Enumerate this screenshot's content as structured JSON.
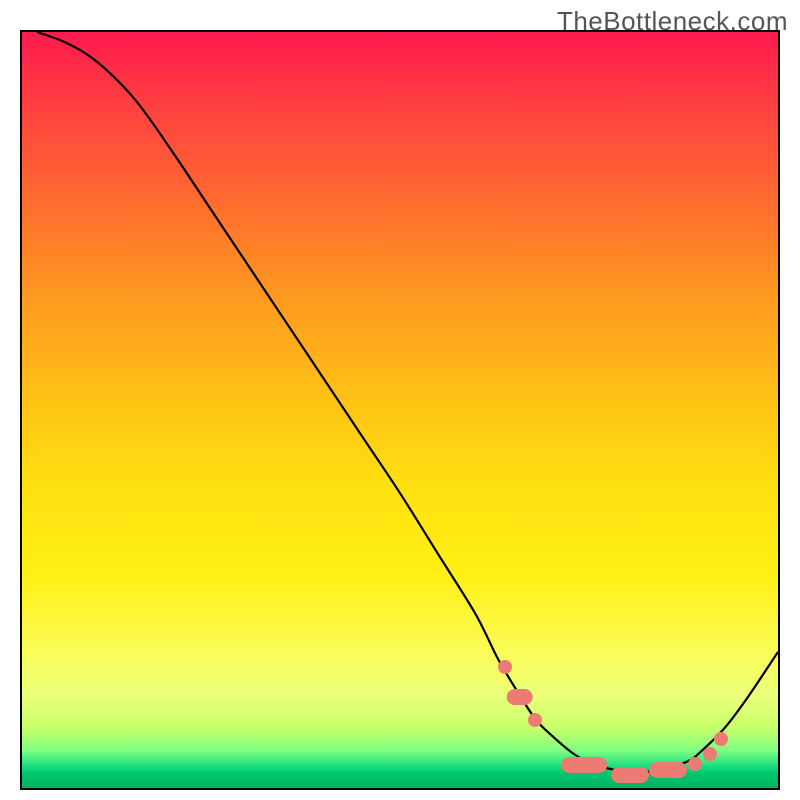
{
  "watermark": "TheBottleneck.com",
  "chart_data": {
    "type": "line",
    "title": "",
    "xlabel": "",
    "ylabel": "",
    "xlim": [
      0,
      100
    ],
    "ylim": [
      0,
      100
    ],
    "grid": false,
    "legend": false,
    "series": [
      {
        "name": "curve",
        "x": [
          2,
          6,
          10,
          15,
          20,
          25,
          30,
          35,
          40,
          45,
          50,
          55,
          60,
          63,
          66,
          68,
          70,
          73,
          76,
          80,
          84,
          88,
          90,
          93,
          96,
          100
        ],
        "y": [
          100,
          98.5,
          96,
          91,
          84,
          76.5,
          69,
          61.5,
          54,
          46.5,
          39,
          31,
          23,
          17,
          12,
          9,
          7,
          4.5,
          3,
          2.2,
          2.3,
          3.5,
          5,
          8,
          12,
          18
        ]
      }
    ],
    "markers": [
      {
        "kind": "dot",
        "x": 63.5,
        "y": 16.5
      },
      {
        "kind": "blob",
        "x": 65.5,
        "y": 12.5,
        "w": 3.5
      },
      {
        "kind": "dot",
        "x": 67.5,
        "y": 9.5
      },
      {
        "kind": "blob",
        "x": 74.0,
        "y": 3.5,
        "w": 6.0
      },
      {
        "kind": "blob",
        "x": 80.0,
        "y": 2.3,
        "w": 5.0
      },
      {
        "kind": "blob",
        "x": 85.0,
        "y": 2.9,
        "w": 5.0
      },
      {
        "kind": "dot",
        "x": 88.5,
        "y": 3.7
      },
      {
        "kind": "dot",
        "x": 90.5,
        "y": 5.0
      },
      {
        "kind": "dot",
        "x": 92.0,
        "y": 7.0
      }
    ],
    "gradient": {
      "type": "vertical",
      "stops": [
        {
          "color": "#ff1a4d",
          "pos": 0.0
        },
        {
          "color": "#ff4040",
          "pos": 0.1
        },
        {
          "color": "#ff6a30",
          "pos": 0.22
        },
        {
          "color": "#ff9920",
          "pos": 0.35
        },
        {
          "color": "#ffc015",
          "pos": 0.48
        },
        {
          "color": "#ffe010",
          "pos": 0.6
        },
        {
          "color": "#fff015",
          "pos": 0.72
        },
        {
          "color": "#fafc58",
          "pos": 0.82
        },
        {
          "color": "#eaff7a",
          "pos": 0.88
        },
        {
          "color": "#c8ff6a",
          "pos": 0.92
        },
        {
          "color": "#80ff80",
          "pos": 0.95
        },
        {
          "color": "#20e080",
          "pos": 0.97
        },
        {
          "color": "#00c870",
          "pos": 0.98
        },
        {
          "color": "#00b060",
          "pos": 1.0
        }
      ]
    }
  }
}
